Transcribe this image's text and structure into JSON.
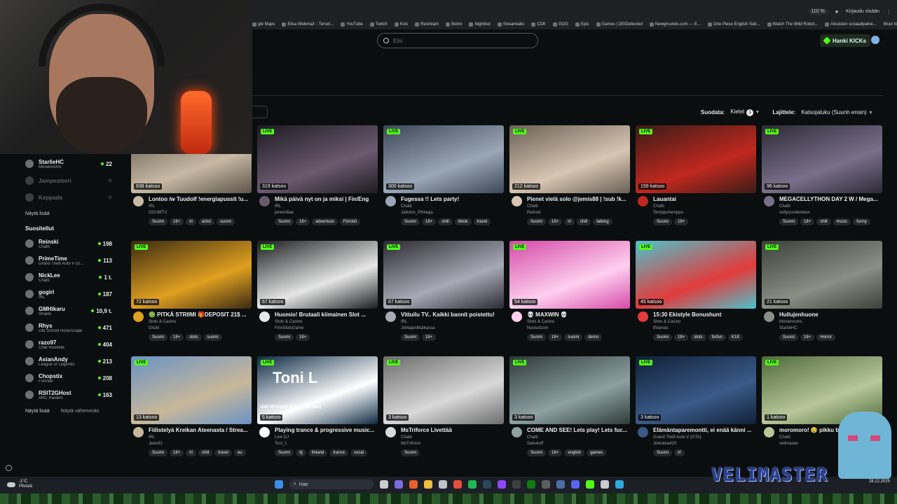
{
  "browser": {
    "zoom": "110 %",
    "signin": "Kirjaudu sisään",
    "bookmarks": [
      "gle Maps",
      "Elisa Webmail :: Tervet...",
      "YouTube",
      "Twitch",
      "Kick",
      "Restream",
      "Botrix",
      "Nightbot",
      "Streamlabs",
      "CDK",
      "GOG",
      "Epic",
      "Games | DEIDetected",
      "Newgrounds.com — E...",
      "One Piece English Sub...",
      "Watch The Wild Robot...",
      "Aikuisten sosiaalipalve..."
    ],
    "bookmarks_folder": "Muut kirjanmerkit"
  },
  "header": {
    "search_placeholder": "Etsi",
    "kicks_button": "Hanki KICKs"
  },
  "filters": {
    "sort_label": "Suodata:",
    "languages": "Kielet",
    "languages_count": "1",
    "order_label": "Lajittele:",
    "order_value": "Katsojaluku (Suurin ensin)"
  },
  "sidebar": {
    "following": [
      {
        "name": "StarlieHC",
        "category": "Movierooms",
        "viewers": "22",
        "live": true
      },
      {
        "name": "Jampesteeri",
        "category": "",
        "viewers": "",
        "live": false
      },
      {
        "name": "Keppada",
        "category": "",
        "viewers": "",
        "live": false
      }
    ],
    "show_more_1": "Näytä lisää",
    "recommended_title": "Suositellut",
    "recommended": [
      {
        "name": "Reinski",
        "category": "Chatti",
        "viewers": "198"
      },
      {
        "name": "PrimeTime",
        "category": "Grand Theft Auto V (G...",
        "viewers": "113"
      },
      {
        "name": "NickLee",
        "category": "Chatti",
        "viewers": "1 t."
      },
      {
        "name": "gogirl",
        "category": "IRL",
        "viewers": "187"
      },
      {
        "name": "GMHikaru",
        "category": "Shakki",
        "viewers": "10,9 t."
      },
      {
        "name": "Rhys",
        "category": "Old School RuneScape",
        "viewers": "471"
      },
      {
        "name": "razo97",
        "category": "Chat Roulette",
        "viewers": "404"
      },
      {
        "name": "AsianAndy",
        "category": "League of Legends",
        "viewers": "213"
      },
      {
        "name": "Chopstix",
        "category": "Fortnite",
        "viewers": "208"
      },
      {
        "name": "RSIT2GHost",
        "category": "ARC Raiders",
        "viewers": "163"
      }
    ],
    "show_more_2": "Näytä lisää",
    "show_less": "Näytä vähemmän"
  },
  "live_badge": "LIVE",
  "streams": [
    {
      "title": "Lontoo /w Tuudolf !energiapussit !u...",
      "category": "IRL",
      "channel": "OGUMTV",
      "viewers": "838 katsoo",
      "tags": [
        "Suomi",
        "18+",
        "irl",
        "artist",
        "suomi"
      ],
      "live": false,
      "thumb": "#5b5449",
      "accent": "#c7b9a4"
    },
    {
      "title": "Mikä päivä nyt on ja miksi | Fin/Eng",
      "category": "IRL",
      "channel": "jenemiliae",
      "viewers": "319 katsoo",
      "tags": [
        "Suomi",
        "18+",
        "adventure",
        "Finnish"
      ],
      "live": true,
      "thumb": "#1e1a22",
      "accent": "#6a5a6e"
    },
    {
      "title": "Fugessa !! Lets party!",
      "category": "Chatti",
      "channel": "Jalluton_Pihtaaja",
      "viewers": "300 katsoo",
      "tags": [
        "Suomi",
        "18+",
        "chill",
        "tiktok",
        "travel"
      ],
      "live": true,
      "thumb": "#3b4756",
      "accent": "#9aa7b6"
    },
    {
      "title": "Pienet vielä solo @jemis88 | !sub !k...",
      "category": "Chatti",
      "channel": "Reinski",
      "viewers": "212 katsoo",
      "tags": [
        "Suomi",
        "18+",
        "irl",
        "chill",
        "talking"
      ],
      "live": true,
      "thumb": "#6a5f55",
      "accent": "#d7c6b2"
    },
    {
      "title": "Lauantai",
      "category": "Chatti",
      "channel": "Temppuhemppu",
      "viewers": "159 katsoo",
      "tags": [
        "Suomi",
        "18+"
      ],
      "live": true,
      "thumb": "#3a1b17",
      "accent": "#c0281f"
    },
    {
      "title": "MEGACELLYTHON DAY 2 W / Mega...",
      "category": "Chatti",
      "channel": "cellyscooterwow",
      "viewers": "96 katsoo",
      "tags": [
        "Suomi",
        "18+",
        "chill",
        "music",
        "funny"
      ],
      "live": true,
      "thumb": "#2c2a36",
      "accent": "#7a6f8a"
    },
    {
      "title": "🟢 PITKÄ STRIIMI 🎁DEPOSIT 21$ ...",
      "category": "Slots & Casino",
      "channel": "Onzki",
      "viewers": "72 katsoo",
      "tags": [
        "Suomi",
        "18+",
        "slots",
        "suomi"
      ],
      "live": true,
      "thumb": "#3a2a12",
      "accent": "#e0a020"
    },
    {
      "title": "Huomio! Brutaali kiimainen Slot ...",
      "category": "Slots & Casino",
      "channel": "FinnSlotsGame",
      "viewers": "67 katsoo",
      "tags": [
        "Suomi",
        "18+"
      ],
      "live": true,
      "thumb": "#1a1d1e",
      "accent": "#e6e6e6"
    },
    {
      "title": "Vittuilu TV.. Kaikki bannit poistettu!",
      "category": "IRL",
      "channel": "JohtajanMatkassa",
      "viewers": "67 katsoo",
      "tags": [
        "Suomi",
        "18+"
      ],
      "live": true,
      "thumb": "#2c2a33",
      "accent": "#a7a9b4"
    },
    {
      "title": "💀 MAXWIN 💀",
      "category": "Slots & Casino",
      "channel": "Nousutcom",
      "viewers": "54 katsoo",
      "tags": [
        "Suomi",
        "18+",
        "suomi",
        "demo"
      ],
      "live": true,
      "thumb": "#d44aa8",
      "accent": "#ffd0ef"
    },
    {
      "title": "15:30 Ekistyle Bonushunt",
      "category": "Slots & Casino",
      "channel": "9Varvas",
      "viewers": "45 katsoo",
      "tags": [
        "Suomi",
        "18+",
        "slots",
        "forfun",
        "K18"
      ],
      "live": true,
      "thumb": "#4cc2cc",
      "accent": "#e33b3b"
    },
    {
      "title": "Hullujenhuone",
      "category": "Movierooms",
      "channel": "StarlieHC",
      "viewers": "21 katsoo",
      "tags": [
        "Suomi",
        "18+",
        "Horror"
      ],
      "live": true,
      "thumb": "#3b4038",
      "accent": "#8a8f86"
    },
    {
      "title": "Fiilistelyä Kreikan Ateenasta / Strea...",
      "category": "IRL",
      "channel": "Jedu92",
      "viewers": "13 katsoo",
      "tags": [
        "Suomi",
        "18+",
        "irl",
        "chill",
        "travel",
        "eu"
      ],
      "live": true,
      "thumb": "#6a93c4",
      "accent": "#c8b89a"
    },
    {
      "title": "Playing trance & progressive music...",
      "category": "Live DJ",
      "channel": "Toni_L",
      "viewers": "5 katsoo",
      "tags": [
        "Suomi",
        "dj",
        "finland",
        "trance",
        "vocal"
      ],
      "live": true,
      "thumb": "#0d2a44",
      "accent": "#ffffff",
      "overlay": "Toni L",
      "overlay2": "UNFORGIVEN (ORIGINAL MIX)"
    },
    {
      "title": "MsTriforce Livettää",
      "category": "Chatti",
      "channel": "MsTriforce",
      "viewers": "3 katsoo",
      "tags": [
        "Suomi"
      ],
      "live": true,
      "thumb": "#6b6b6b",
      "accent": "#d9d9d9"
    },
    {
      "title": "COME AND SEE! Lets play! Lets fuc...",
      "category": "Chatti",
      "channel": "Sakukoff",
      "viewers": "3 katsoo",
      "tags": [
        "Suomi",
        "18+",
        "english",
        "games"
      ],
      "live": true,
      "thumb": "#2e3a3b",
      "accent": "#8da0a2"
    },
    {
      "title": "Elämäntaparemontti, ei enää känni ...",
      "category": "Grand Theft Auto V (GTA)",
      "channel": "Jolkukka420",
      "viewers": "3 katsoo",
      "tags": [
        "Suomi",
        "irl"
      ],
      "live": true,
      "thumb": "#102036",
      "accent": "#3a5a88"
    },
    {
      "title": "moromoro! 🤤 pikku b...",
      "category": "Chatti",
      "channel": "velimaster",
      "viewers": "1 katsoo",
      "tags": [],
      "live": true,
      "thumb": "#4f6a3a",
      "accent": "#b7c79a"
    }
  ],
  "taskbar": {
    "weather_temp": "-1°C",
    "weather_text": "Pilvistä",
    "search": "Hae",
    "date": "28.12.2025"
  },
  "overlay": {
    "brand": "VELIMASTER"
  }
}
